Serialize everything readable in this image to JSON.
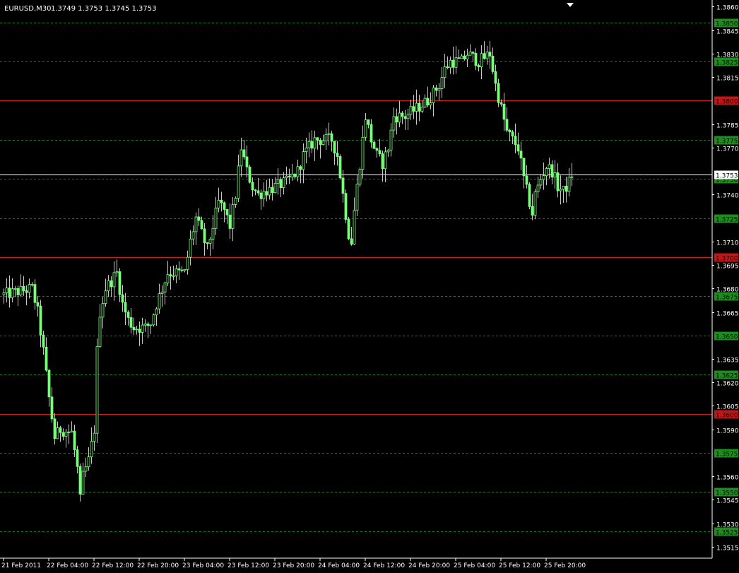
{
  "header": {
    "symbol_label": "EURUSD,M30",
    "ohlc_label": "1.3749 1.3753 1.3745 1.3753"
  },
  "current_price_label": "1.3753",
  "colors": {
    "background": "#000000",
    "candle": "#7CFC7C",
    "grid": "#1f7a1f",
    "red_line": "#d21a1a",
    "current_line": "#ffffff",
    "axis_text": "#ffffff",
    "green_badge": "#1e8c1e",
    "red_badge": "#c81414"
  },
  "chart_data": {
    "type": "candlestick",
    "ylim": [
      1.351,
      1.3862
    ],
    "y_ticks": [
      "1.3860",
      "1.3845",
      "1.3830",
      "1.3815",
      "1.3785",
      "1.3770",
      "1.3740",
      "1.3710",
      "1.3695",
      "1.3680",
      "1.3665",
      "1.3635",
      "1.3620",
      "1.3605",
      "1.3590",
      "1.3560",
      "1.3545",
      "1.3530",
      "1.3515"
    ],
    "tick_values": [
      1.386,
      1.3845,
      1.383,
      1.3815,
      1.3785,
      1.377,
      1.374,
      1.371,
      1.3695,
      1.368,
      1.3665,
      1.3635,
      1.362,
      1.3605,
      1.359,
      1.356,
      1.3545,
      1.353,
      1.3515
    ],
    "green_levels": [
      {
        "value": 1.385,
        "label": "1.3850"
      },
      {
        "value": 1.3825,
        "label": "1.3825"
      },
      {
        "value": 1.3775,
        "label": "1.3775"
      },
      {
        "value": 1.375,
        "label": "1.3750"
      },
      {
        "value": 1.3725,
        "label": "1.3725"
      },
      {
        "value": 1.3675,
        "label": "1.3675"
      },
      {
        "value": 1.365,
        "label": "1.3650"
      },
      {
        "value": 1.3625,
        "label": "1.3625"
      },
      {
        "value": 1.3575,
        "label": "1.3575"
      },
      {
        "value": 1.355,
        "label": "1.3550"
      },
      {
        "value": 1.3525,
        "label": "1.3525"
      }
    ],
    "red_levels": [
      {
        "value": 1.38,
        "label": "1.3800"
      },
      {
        "value": 1.37,
        "label": "1.3700"
      },
      {
        "value": 1.36,
        "label": "1.3600"
      }
    ],
    "current_price": 1.3753,
    "x_labels": [
      "21 Feb 2011",
      "22 Feb 04:00",
      "22 Feb 12:00",
      "22 Feb 20:00",
      "23 Feb 04:00",
      "23 Feb 12:00",
      "23 Feb 20:00",
      "24 Feb 04:00",
      "24 Feb 12:00",
      "24 Feb 20:00",
      "25 Feb 04:00",
      "25 Feb 12:00",
      "25 Feb 20:00"
    ],
    "x_label_bars": [
      0,
      16,
      32,
      48,
      64,
      80,
      96,
      112,
      128,
      144,
      160,
      176,
      192
    ],
    "close_path": [
      [
        0,
        1.3676
      ],
      [
        10,
        1.368
      ],
      [
        12,
        1.3665
      ],
      [
        14,
        1.364
      ],
      [
        16,
        1.361
      ],
      [
        18,
        1.3585
      ],
      [
        20,
        1.359
      ],
      [
        24,
        1.3588
      ],
      [
        26,
        1.3565
      ],
      [
        27,
        1.3545
      ],
      [
        28,
        1.356
      ],
      [
        30,
        1.357
      ],
      [
        32,
        1.359
      ],
      [
        33,
        1.364
      ],
      [
        34,
        1.3665
      ],
      [
        36,
        1.368
      ],
      [
        40,
        1.369
      ],
      [
        42,
        1.367
      ],
      [
        44,
        1.366
      ],
      [
        46,
        1.3655
      ],
      [
        50,
        1.3655
      ],
      [
        52,
        1.3658
      ],
      [
        54,
        1.367
      ],
      [
        56,
        1.368
      ],
      [
        58,
        1.369
      ],
      [
        62,
        1.369
      ],
      [
        64,
        1.369
      ],
      [
        66,
        1.371
      ],
      [
        68,
        1.3725
      ],
      [
        70,
        1.3715
      ],
      [
        72,
        1.3705
      ],
      [
        74,
        1.372
      ],
      [
        76,
        1.3735
      ],
      [
        78,
        1.373
      ],
      [
        80,
        1.372
      ],
      [
        82,
        1.374
      ],
      [
        84,
        1.377
      ],
      [
        86,
        1.3755
      ],
      [
        88,
        1.3745
      ],
      [
        90,
        1.374
      ],
      [
        92,
        1.3742
      ],
      [
        96,
        1.3745
      ],
      [
        100,
        1.3748
      ],
      [
        104,
        1.3755
      ],
      [
        106,
        1.3765
      ],
      [
        110,
        1.3775
      ],
      [
        116,
        1.3775
      ],
      [
        118,
        1.3765
      ],
      [
        120,
        1.374
      ],
      [
        122,
        1.3715
      ],
      [
        123,
        1.371
      ],
      [
        124,
        1.373
      ],
      [
        126,
        1.376
      ],
      [
        128,
        1.379
      ],
      [
        130,
        1.3775
      ],
      [
        132,
        1.3765
      ],
      [
        134,
        1.376
      ],
      [
        136,
        1.377
      ],
      [
        138,
        1.379
      ],
      [
        142,
        1.379
      ],
      [
        146,
        1.3795
      ],
      [
        150,
        1.38
      ],
      [
        154,
        1.381
      ],
      [
        156,
        1.382
      ],
      [
        158,
        1.3825
      ],
      [
        162,
        1.3825
      ],
      [
        164,
        1.383
      ],
      [
        168,
        1.3825
      ],
      [
        172,
        1.383
      ],
      [
        174,
        1.381
      ],
      [
        176,
        1.3795
      ],
      [
        178,
        1.378
      ],
      [
        180,
        1.3775
      ],
      [
        182,
        1.377
      ],
      [
        184,
        1.375
      ],
      [
        186,
        1.3735
      ],
      [
        187,
        1.3728
      ],
      [
        188,
        1.374
      ],
      [
        190,
        1.375
      ],
      [
        192,
        1.3758
      ],
      [
        194,
        1.3755
      ],
      [
        196,
        1.3745
      ],
      [
        198,
        1.3742
      ],
      [
        200,
        1.3748
      ],
      [
        201,
        1.3753
      ]
    ]
  }
}
